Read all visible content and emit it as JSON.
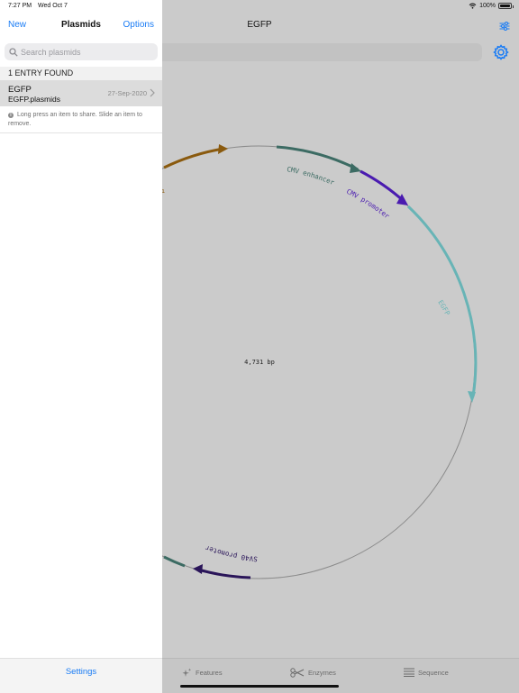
{
  "status": {
    "time": "7:27 PM",
    "date": "Wed Oct 7",
    "battery": "100%"
  },
  "sidebar": {
    "new_label": "New",
    "title": "Plasmids",
    "options_label": "Options",
    "search_placeholder": "Search plasmids",
    "entries_header": "1 ENTRY FOUND",
    "entries": [
      {
        "name": "EGFP",
        "file": "EGFP.plasmids",
        "date": "27-Sep-2020"
      }
    ],
    "hint": "Long press an item to share. Slide an item to remove.",
    "settings_label": "Settings"
  },
  "main": {
    "title": "EGFP",
    "total_length": "4,731 bp",
    "features": [
      {
        "name": "CMV enhancer",
        "color": "#3c6b63"
      },
      {
        "name": "CMV promoter",
        "color": "#4a1bb0"
      },
      {
        "name": "EGFP",
        "color": "#68b4b6"
      },
      {
        "name": "SV40 promoter",
        "color": "#2a1559"
      },
      {
        "name": "",
        "color": "#8a5a0e"
      },
      {
        "name": "",
        "color": "#3c6b63"
      }
    ],
    "tabs": [
      {
        "label": "Features",
        "icon": "sparkle-icon"
      },
      {
        "label": "Enzymes",
        "icon": "scissors-icon"
      },
      {
        "label": "Sequence",
        "icon": "lines-icon"
      }
    ]
  }
}
